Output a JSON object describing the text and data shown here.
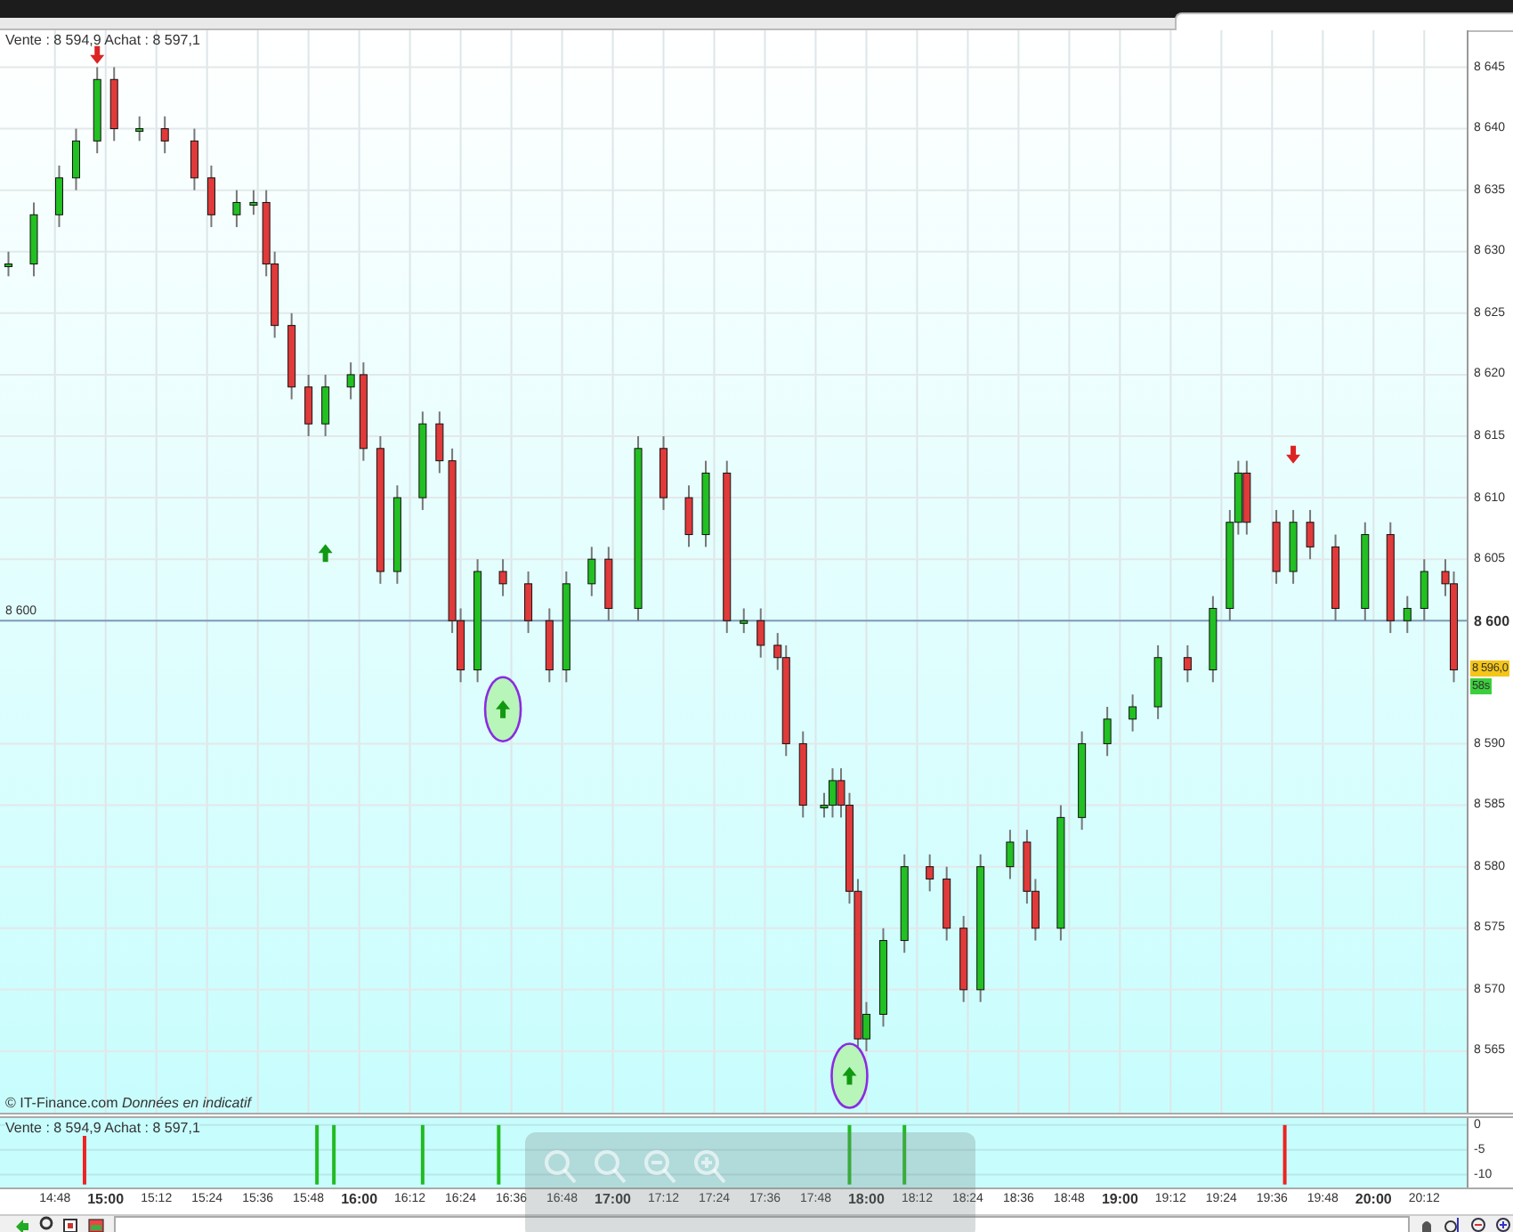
{
  "main_chart": {
    "quote": "Vente : 8 594,9 Achat : 8 597,1",
    "chart_data": {
      "type": "candlestick",
      "x": [
        877,
        883,
        889,
        893,
        898,
        902,
        908,
        914,
        921,
        925,
        931,
        935,
        938,
        940,
        944,
        948,
        952,
        958,
        961,
        965,
        969,
        975,
        979,
        982,
        984,
        988,
        994,
        1000,
        1005,
        1009,
        1015,
        1019,
        1026,
        1032,
        1038,
        1042,
        1047,
        1051,
        1055,
        1059,
        1061,
        1065,
        1070,
        1072,
        1074,
        1076,
        1078,
        1080,
        1084,
        1089,
        1095,
        1099,
        1103,
        1107,
        1114,
        1118,
        1120,
        1126,
        1131,
        1137,
        1143,
        1149,
        1156,
        1162,
        1166,
        1168,
        1170,
        1177,
        1181,
        1185,
        1191,
        1198,
        1204,
        1208,
        1212,
        1217,
        1219
      ],
      "ohlc": [
        [
          8629,
          8630,
          8628,
          8629
        ],
        [
          8629,
          8634,
          8628,
          8633
        ],
        [
          8633,
          8637,
          8632,
          8636
        ],
        [
          8636,
          8640,
          8635,
          8639
        ],
        [
          8639,
          8645,
          8638,
          8644
        ],
        [
          8644,
          8645,
          8639,
          8640
        ],
        [
          8640,
          8641,
          8639,
          8640
        ],
        [
          8640,
          8641,
          8638,
          8639
        ],
        [
          8639,
          8640,
          8635,
          8636
        ],
        [
          8636,
          8637,
          8632,
          8633
        ],
        [
          8633,
          8635,
          8632,
          8634
        ],
        [
          8634,
          8635,
          8633,
          8634
        ],
        [
          8634,
          8635,
          8628,
          8629
        ],
        [
          8629,
          8630,
          8623,
          8624
        ],
        [
          8624,
          8625,
          8618,
          8619
        ],
        [
          8619,
          8620,
          8615,
          8616
        ],
        [
          8616,
          8620,
          8615,
          8619
        ],
        [
          8619,
          8621,
          8618,
          8620
        ],
        [
          8620,
          8621,
          8613,
          8614
        ],
        [
          8614,
          8615,
          8603,
          8604
        ],
        [
          8604,
          8611,
          8603,
          8610
        ],
        [
          8610,
          8617,
          8609,
          8616
        ],
        [
          8616,
          8617,
          8612,
          8613
        ],
        [
          8613,
          8614,
          8599,
          8600
        ],
        [
          8600,
          8601,
          8595,
          8596
        ],
        [
          8596,
          8605,
          8595,
          8604
        ],
        [
          8604,
          8605,
          8602,
          8603
        ],
        [
          8603,
          8604,
          8599,
          8600
        ],
        [
          8600,
          8601,
          8595,
          8596
        ],
        [
          8596,
          8604,
          8595,
          8603
        ],
        [
          8603,
          8606,
          8602,
          8605
        ],
        [
          8605,
          8606,
          8600,
          8601
        ],
        [
          8601,
          8615,
          8600,
          8614
        ],
        [
          8614,
          8615,
          8609,
          8610
        ],
        [
          8610,
          8611,
          8606,
          8607
        ],
        [
          8607,
          8613,
          8606,
          8612
        ],
        [
          8612,
          8613,
          8599,
          8600
        ],
        [
          8600,
          8601,
          8599,
          8600
        ],
        [
          8600,
          8601,
          8597,
          8598
        ],
        [
          8598,
          8599,
          8596,
          8597
        ],
        [
          8597,
          8598,
          8589,
          8590
        ],
        [
          8590,
          8591,
          8584,
          8585
        ],
        [
          8585,
          8586,
          8584,
          8585
        ],
        [
          8585,
          8588,
          8584,
          8587
        ],
        [
          8587,
          8588,
          8584,
          8585
        ],
        [
          8585,
          8586,
          8577,
          8578
        ],
        [
          8578,
          8579,
          8565,
          8566
        ],
        [
          8566,
          8569,
          8565,
          8568
        ],
        [
          8568,
          8575,
          8567,
          8574
        ],
        [
          8574,
          8581,
          8573,
          8580
        ],
        [
          8580,
          8581,
          8578,
          8579
        ],
        [
          8579,
          8580,
          8574,
          8575
        ],
        [
          8575,
          8576,
          8569,
          8570
        ],
        [
          8570,
          8581,
          8569,
          8580
        ],
        [
          8580,
          8583,
          8579,
          8582
        ],
        [
          8582,
          8583,
          8577,
          8578
        ],
        [
          8578,
          8579,
          8574,
          8575
        ],
        [
          8575,
          8585,
          8574,
          8584
        ],
        [
          8584,
          8591,
          8583,
          8590
        ],
        [
          8590,
          8593,
          8589,
          8592
        ],
        [
          8592,
          8594,
          8591,
          8593
        ],
        [
          8593,
          8598,
          8592,
          8597
        ],
        [
          8597,
          8598,
          8595,
          8596
        ],
        [
          8596,
          8602,
          8595,
          8601
        ],
        [
          8601,
          8609,
          8600,
          8608
        ],
        [
          8608,
          8613,
          8607,
          8612
        ],
        [
          8612,
          8613,
          8607,
          8608
        ],
        [
          8608,
          8609,
          8603,
          8604
        ],
        [
          8604,
          8609,
          8603,
          8608
        ],
        [
          8608,
          8609,
          8605,
          8606
        ],
        [
          8606,
          8607,
          8600,
          8601
        ],
        [
          8601,
          8608,
          8600,
          8607
        ],
        [
          8607,
          8608,
          8599,
          8600
        ],
        [
          8600,
          8602,
          8599,
          8601
        ],
        [
          8601,
          8605,
          8600,
          8604
        ],
        [
          8604,
          8605,
          8602,
          8603
        ],
        [
          8603,
          8604,
          8595,
          8596
        ]
      ],
      "series": [
        {
          "type": "scatter",
          "color": "#dd2222",
          "values": [
            null,
            null,
            null,
            null,
            8646,
            null,
            null,
            null,
            null,
            null,
            null,
            null,
            null,
            null,
            null,
            null,
            null,
            null,
            null,
            null,
            null,
            null,
            null,
            null,
            null,
            null,
            null,
            null,
            null,
            null,
            null,
            null,
            null,
            null,
            null,
            null,
            null,
            null,
            null,
            null,
            null,
            null,
            null,
            null,
            null,
            null,
            null,
            null,
            null,
            null,
            null,
            null,
            null,
            null,
            null,
            null,
            null,
            null,
            null,
            null,
            null,
            null,
            null,
            null,
            null,
            null,
            null,
            null,
            8613.5,
            null,
            null,
            null,
            null,
            null,
            null,
            null,
            null
          ]
        },
        {
          "type": "scatter",
          "color": "#119911",
          "values": [
            null,
            null,
            null,
            null,
            null,
            null,
            null,
            null,
            null,
            null,
            null,
            null,
            null,
            null,
            null,
            null,
            8605.5,
            null,
            null,
            null,
            null,
            null,
            null,
            null,
            null,
            null,
            null,
            null,
            null,
            null,
            null,
            null,
            null,
            null,
            null,
            null,
            null,
            null,
            null,
            null,
            null,
            null,
            null,
            null,
            null,
            null,
            null,
            null,
            null,
            null,
            null,
            null,
            null,
            null,
            null,
            null,
            null,
            null,
            null,
            null,
            null,
            null,
            null,
            null,
            null,
            null,
            null,
            null,
            null,
            null,
            null,
            null,
            null,
            null,
            null,
            null,
            null
          ]
        },
        {
          "type": "scatter",
          "marker": "circle",
          "color": "#119911",
          "values": [
            null,
            null,
            null,
            null,
            null,
            null,
            null,
            null,
            null,
            null,
            null,
            null,
            null,
            null,
            null,
            null,
            null,
            null,
            null,
            null,
            null,
            null,
            null,
            null,
            null,
            null,
            8592.8,
            null,
            null,
            null,
            null,
            null,
            null,
            null,
            null,
            null,
            null,
            null,
            null,
            null,
            null,
            null,
            null,
            null,
            null,
            8563,
            null,
            null,
            null,
            null,
            null,
            null,
            null,
            null,
            null,
            null,
            null,
            null,
            null,
            null,
            null,
            null,
            null,
            null,
            null,
            null,
            null,
            null,
            null,
            null,
            null,
            null,
            null,
            null,
            null,
            null,
            null
          ]
        }
      ],
      "xlim": [
        875,
        1233
      ],
      "ylim": [
        8560,
        8648
      ],
      "grid": true,
      "xticks": [
        {
          "value": 888,
          "label": "14:48"
        },
        {
          "value": 900,
          "label": "15:00"
        },
        {
          "value": 912,
          "label": "15:12"
        },
        {
          "value": 924,
          "label": "15:24"
        },
        {
          "value": 936,
          "label": "15:36"
        },
        {
          "value": 948,
          "label": "15:48"
        },
        {
          "value": 960,
          "label": "16:00"
        },
        {
          "value": 972,
          "label": "16:12"
        },
        {
          "value": 984,
          "label": "16:24"
        },
        {
          "value": 996,
          "label": "16:36"
        },
        {
          "value": 1008,
          "label": "16:48"
        },
        {
          "value": 1020,
          "label": "17:00"
        },
        {
          "value": 1032,
          "label": "17:12"
        },
        {
          "value": 1044,
          "label": "17:24"
        },
        {
          "value": 1056,
          "label": "17:36"
        },
        {
          "value": 1068,
          "label": "17:48"
        },
        {
          "value": 1080,
          "label": "18:00"
        },
        {
          "value": 1092,
          "label": "18:12"
        },
        {
          "value": 1104,
          "label": "18:24"
        },
        {
          "value": 1116,
          "label": "18:36"
        },
        {
          "value": 1128,
          "label": "18:48"
        },
        {
          "value": 1140,
          "label": "19:00"
        },
        {
          "value": 1152,
          "label": "19:12"
        },
        {
          "value": 1164,
          "label": "19:24"
        },
        {
          "value": 1176,
          "label": "19:36"
        },
        {
          "value": 1188,
          "label": "19:48"
        },
        {
          "value": 1200,
          "label": "20:00"
        },
        {
          "value": 1212,
          "label": "20:12"
        }
      ],
      "yticks": [
        {
          "value": 8565,
          "label": "8 565"
        },
        {
          "value": 8570,
          "label": "8 570"
        },
        {
          "value": 8575,
          "label": "8 575"
        },
        {
          "value": 8580,
          "label": "8 580"
        },
        {
          "value": 8585,
          "label": "8 585"
        },
        {
          "value": 8590,
          "label": "8 590"
        },
        {
          "value": 8600,
          "label": "8 600"
        },
        {
          "value": 8605,
          "label": "8 605"
        },
        {
          "value": 8610,
          "label": "8 610"
        },
        {
          "value": 8615,
          "label": "8 615"
        },
        {
          "value": 8620,
          "label": "8 620"
        },
        {
          "value": 8625,
          "label": "8 625"
        },
        {
          "value": 8630,
          "label": "8 630"
        },
        {
          "value": 8635,
          "label": "8 635"
        },
        {
          "value": 8640,
          "label": "8 640"
        },
        {
          "value": 8645,
          "label": "8 645"
        }
      ],
      "ref_lines": [
        {
          "axis": "y",
          "value": 8600,
          "label": "8 600"
        }
      ]
    },
    "last_price": {
      "label": "8 596,0",
      "timer": "58s"
    },
    "copyright": "© IT-Finance.com  *Données en indicatif*"
  },
  "signal_panel": {
    "quote": "Vente : 8 594,9 Achat : 8 597,1",
    "chart_data": {
      "type": "bar",
      "x": [
        895,
        950,
        954,
        975,
        993,
        1076,
        1089,
        1179
      ],
      "series": [
        {
          "color": "#ee2222",
          "values": [
            -12,
            null,
            null,
            null,
            null,
            null,
            null,
            -12
          ]
        },
        {
          "color": "#22bb22",
          "values": [
            null,
            -12,
            -12,
            -12,
            -12,
            -12,
            -12,
            null
          ]
        }
      ],
      "xlim": [
        875,
        1233
      ],
      "ylim": [
        -12.6,
        1.4
      ],
      "grid": true,
      "yticks": [
        {
          "value": 0,
          "label": "0"
        },
        {
          "value": -5,
          "label": "-5"
        },
        {
          "value": -10,
          "label": "-10"
        }
      ]
    }
  }
}
